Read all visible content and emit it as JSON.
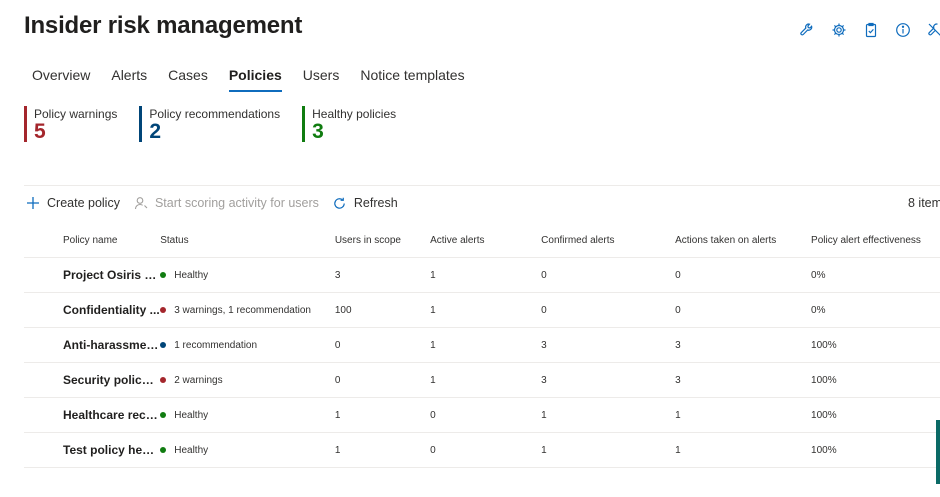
{
  "page": {
    "title": "Insider risk management"
  },
  "header_icons": [
    "wrench-icon",
    "gear-icon",
    "clipboard-check-icon",
    "info-icon",
    "no-tools-icon"
  ],
  "tabs": [
    {
      "label": "Overview"
    },
    {
      "label": "Alerts"
    },
    {
      "label": "Cases"
    },
    {
      "label": "Policies",
      "active": true
    },
    {
      "label": "Users"
    },
    {
      "label": "Notice templates"
    }
  ],
  "stats": [
    {
      "label": "Policy warnings",
      "value": "5",
      "color": "#a4262c"
    },
    {
      "label": "Policy recommendations",
      "value": "2",
      "color": "#004578"
    },
    {
      "label": "Healthy policies",
      "value": "3",
      "color": "#107c10"
    }
  ],
  "toolbar": {
    "create": "Create policy",
    "scoring": "Start scoring activity for users",
    "refresh": "Refresh",
    "count": "8 item"
  },
  "table": {
    "headers": {
      "name": "Policy name",
      "status": "Status",
      "users": "Users in scope",
      "active": "Active alerts",
      "confirmed": "Confirmed alerts",
      "actions": "Actions taken on alerts",
      "effectiveness": "Policy alert effectiveness"
    },
    "rows": [
      {
        "name": "Project Osiris C...",
        "status": "Healthy",
        "status_color": "#107c10",
        "users": "3",
        "active": "1",
        "confirmed": "0",
        "actions": "0",
        "effectiveness": "0%"
      },
      {
        "name": "Confidentiality ...",
        "status": "3 warnings, 1 recommendation",
        "status_color": "#a4262c",
        "users": "100",
        "active": "1",
        "confirmed": "0",
        "actions": "0",
        "effectiveness": "0%"
      },
      {
        "name": "Anti-harassmen...",
        "status": "1 recommendation",
        "status_color": "#004578",
        "users": "0",
        "active": "1",
        "confirmed": "3",
        "actions": "3",
        "effectiveness": "100%"
      },
      {
        "name": "Security policy ...",
        "status": "2 warnings",
        "status_color": "#a4262c",
        "users": "0",
        "active": "1",
        "confirmed": "3",
        "actions": "3",
        "effectiveness": "100%"
      },
      {
        "name": "Healthcare reco...",
        "status": "Healthy",
        "status_color": "#107c10",
        "users": "1",
        "active": "0",
        "confirmed": "1",
        "actions": "1",
        "effectiveness": "100%"
      },
      {
        "name": "Test policy healt...",
        "status": "Healthy",
        "status_color": "#107c10",
        "users": "1",
        "active": "0",
        "confirmed": "1",
        "actions": "1",
        "effectiveness": "100%"
      }
    ]
  }
}
